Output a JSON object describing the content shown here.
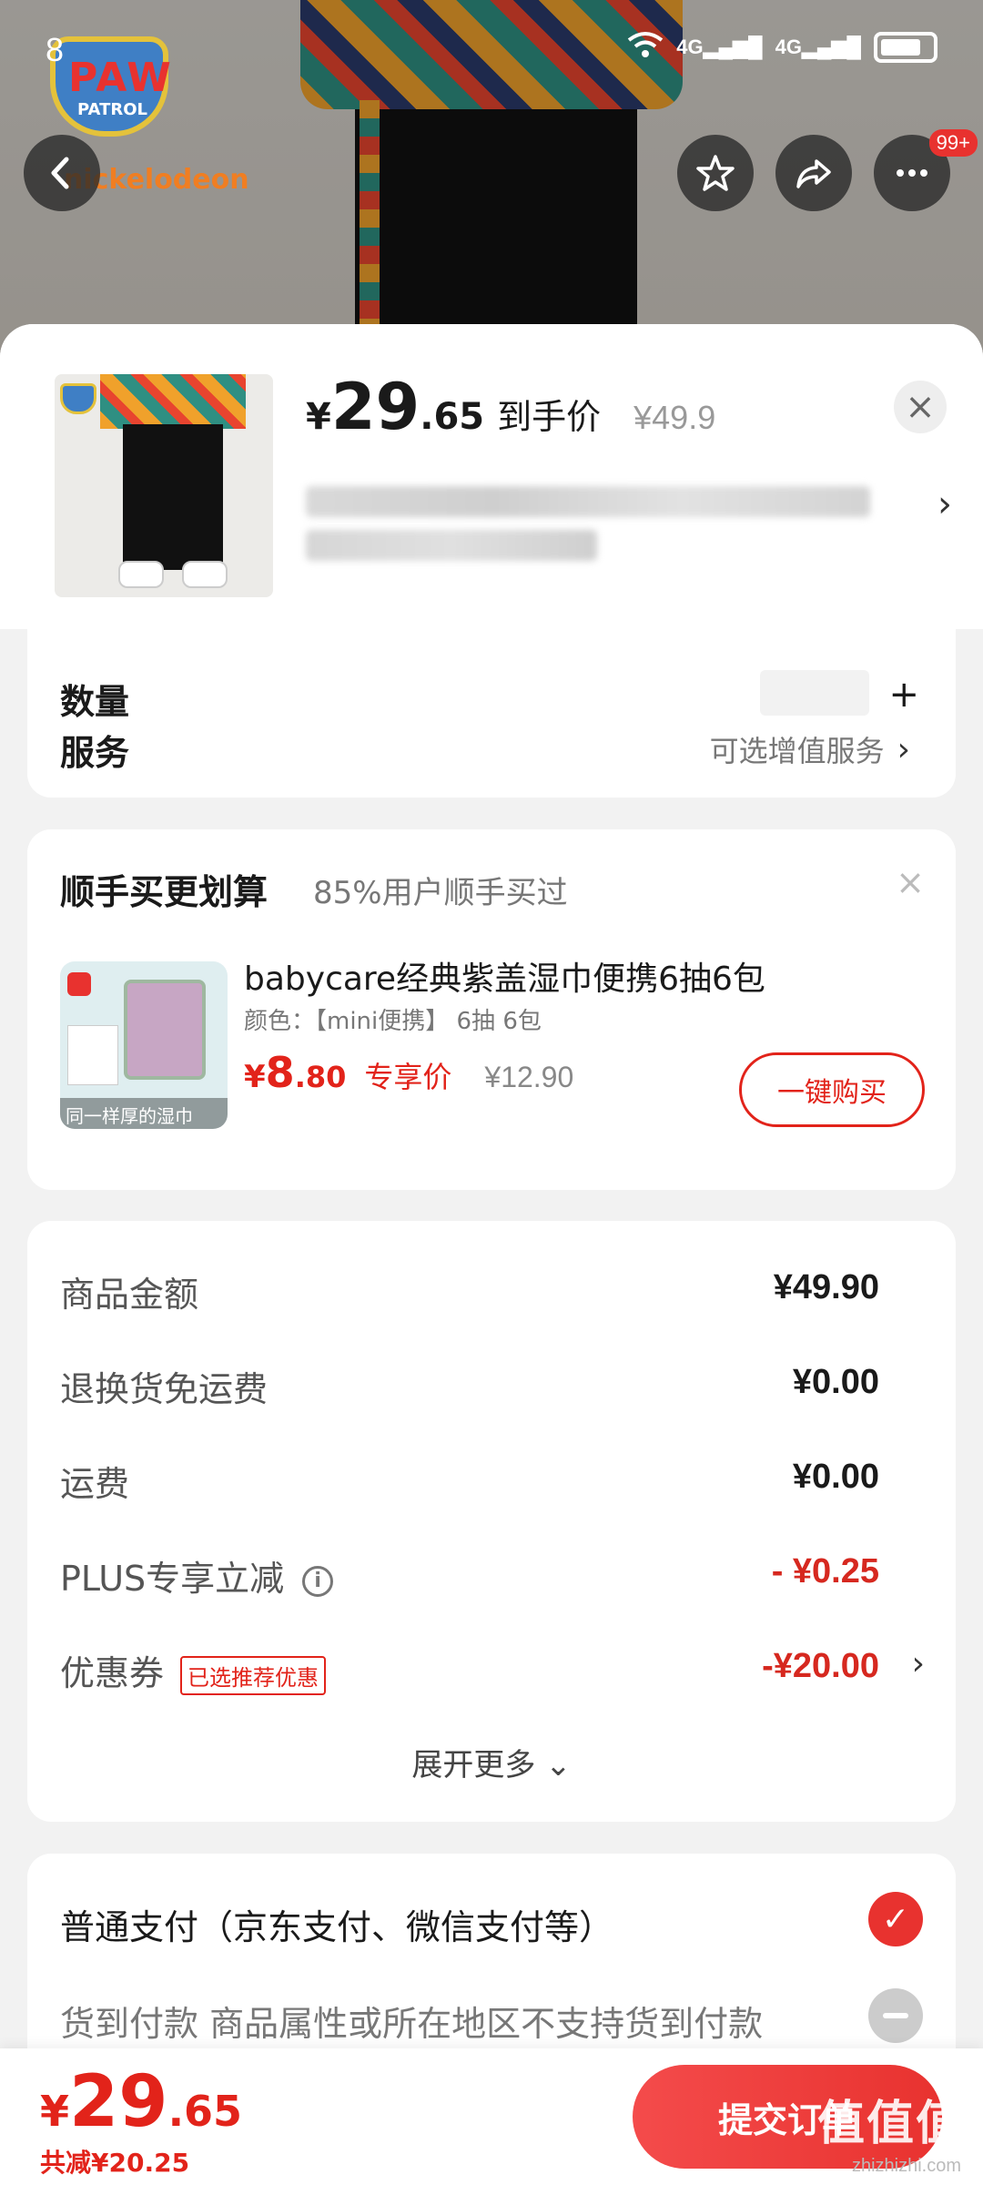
{
  "status_bar": {
    "time": "8",
    "net1": "4G",
    "net2": "4G"
  },
  "top_actions": {
    "more_badge": "99+"
  },
  "brand": {
    "name": "PAW",
    "sub": "PATROL",
    "maker": "nickelodeon"
  },
  "header": {
    "price_symbol": "¥",
    "price_int": "29",
    "price_dec": ".65",
    "price_tag": "到手价",
    "original_price": "¥49.9"
  },
  "service": {
    "qty_label": "数量",
    "label": "服务",
    "value": "可选增值服务"
  },
  "bundle": {
    "title": "顺手买更划算",
    "subtitle": "85%用户顺手买过",
    "product_name": "babycare经典紫盖湿巾便携6抽6包",
    "spec": "颜色：【mini便携】 6抽 6包",
    "image_caption": "同一样厚的湿巾",
    "price_symbol": "¥",
    "price_int": "8",
    "price_dec": ".80",
    "price_tag": "专享价",
    "original_price": "¥12.90",
    "buy_label": "一键购买"
  },
  "summary": {
    "rows": [
      {
        "label": "商品金额",
        "value": "¥49.90"
      },
      {
        "label": "退换货免运费",
        "value": "¥0.00"
      },
      {
        "label": "运费",
        "value": "¥0.00"
      },
      {
        "label": "PLUS专享立减",
        "value": "- ¥0.25"
      },
      {
        "label": "优惠券",
        "tag": "已选推荐优惠",
        "value": "-¥20.00"
      }
    ],
    "expand_label": "展开更多 ⌄"
  },
  "payment": {
    "options": [
      {
        "label": "普通支付（京东支付、微信支付等）",
        "selected": true
      },
      {
        "label": "货到付款  商品属性或所在地区不支持货到付款",
        "selected": false
      }
    ]
  },
  "bottom": {
    "price_symbol": "¥",
    "price_int": "29",
    "price_dec": ".65",
    "saved": "共减¥20.25",
    "submit_label": "提交订单",
    "watermark": "值值值",
    "watermark_sub": "zhizhizhi.com"
  },
  "colors": {
    "accent": "#e2231a",
    "sheet_bg": "#f2f2f2"
  }
}
